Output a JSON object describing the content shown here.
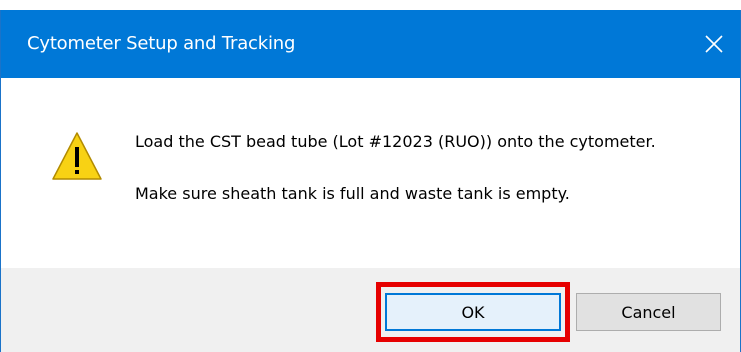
{
  "dialog": {
    "title": "Cytometer Setup and Tracking",
    "close_icon": "close-icon",
    "warning_icon": "warning-icon",
    "message_line1": "Load the CST bead tube (Lot #12023 (RUO)) onto the cytometer.",
    "message_line2": "Make sure sheath tank is full and waste tank is empty.",
    "buttons": {
      "ok_label": "OK",
      "cancel_label": "Cancel"
    }
  },
  "colors": {
    "titlebar": "#0078d7",
    "highlight": "#e60000",
    "warning_fill": "#f8d214"
  }
}
